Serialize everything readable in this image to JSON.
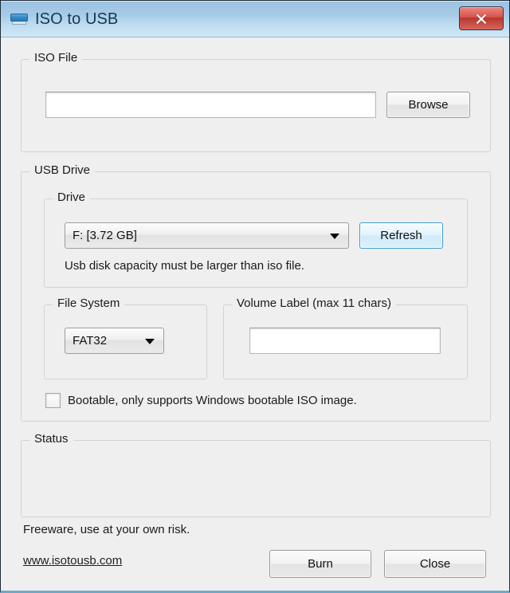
{
  "window": {
    "title": "ISO to USB",
    "app_icon": "usb-drive-icon",
    "close_label": "✕",
    "accent_titlebar": "#a9cbe6",
    "accent_close": "#c0392b",
    "background": "#efefef",
    "focus_accent": "#3c9bd4"
  },
  "iso_file": {
    "legend": "ISO File",
    "path_value": "",
    "path_placeholder": "",
    "browse_label": "Browse"
  },
  "usb_drive": {
    "legend": "USB Drive",
    "drive": {
      "legend": "Drive",
      "selected": "F: [3.72 GB]",
      "options": [
        "F: [3.72 GB]"
      ],
      "refresh_label": "Refresh",
      "hint": "Usb disk capacity must be larger than iso file."
    },
    "file_system": {
      "legend": "File System",
      "selected": "FAT32",
      "options": [
        "FAT32"
      ]
    },
    "volume_label": {
      "legend": "Volume Label (max 11 chars)",
      "value": "",
      "placeholder": ""
    },
    "bootable": {
      "label": "Bootable, only supports Windows bootable ISO image.",
      "checked": false
    }
  },
  "status": {
    "legend": "Status",
    "message": ""
  },
  "footer": {
    "disclaimer": "Freeware, use at your own risk.",
    "website": "www.isotousb.com",
    "burn_label": "Burn",
    "close_label": "Close"
  }
}
